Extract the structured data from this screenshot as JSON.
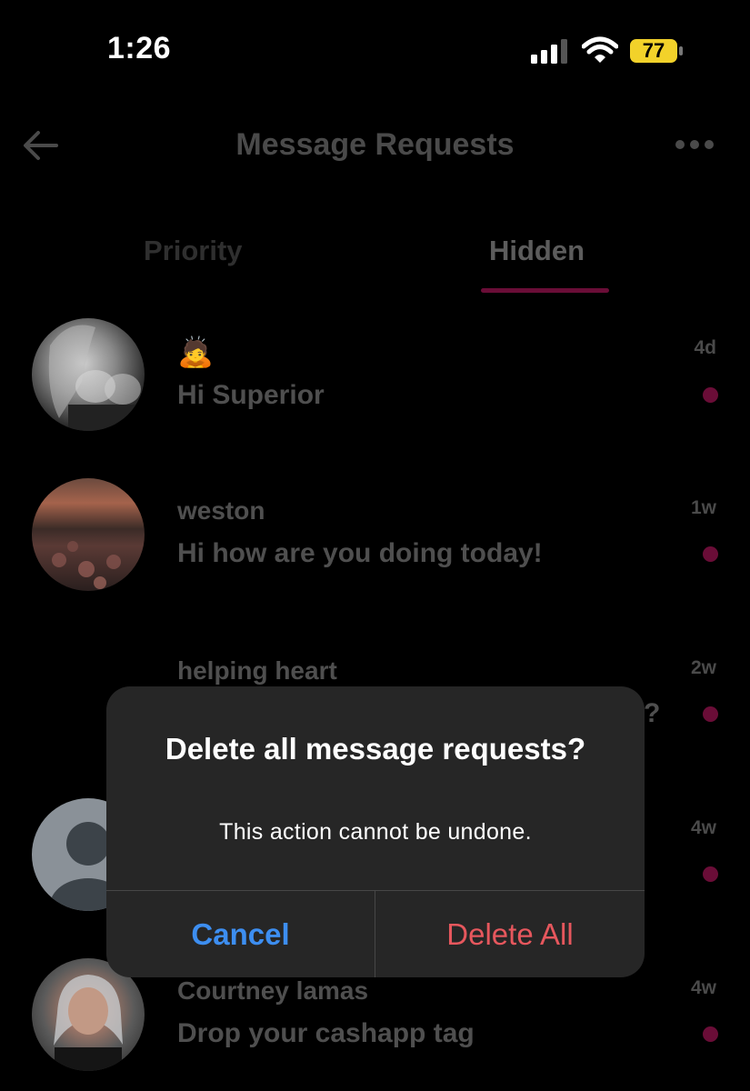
{
  "status_bar": {
    "time": "1:26",
    "battery": "77"
  },
  "header": {
    "title": "Message Requests"
  },
  "tabs": [
    {
      "label": "Priority",
      "selected": false
    },
    {
      "label": "Hidden",
      "selected": true
    }
  ],
  "requests": [
    {
      "name": "🙇",
      "preview": "Hi Superior",
      "time": "4d",
      "unread": true
    },
    {
      "name": "weston",
      "preview": "Hi how are you doing today!",
      "time": "1w",
      "unread": true
    },
    {
      "name": "helping heart",
      "preview": "?",
      "time": "2w",
      "unread": true
    },
    {
      "name": "",
      "preview": "",
      "time": "4w",
      "unread": true
    },
    {
      "name": "Courtney lamas",
      "preview": "Drop your cashapp tag",
      "time": "4w",
      "unread": true
    }
  ],
  "dialog": {
    "title": "Delete all message requests?",
    "message": "This action cannot be undone.",
    "cancel_label": "Cancel",
    "delete_label": "Delete All"
  },
  "colors": {
    "accent": "#6a0d37",
    "cancel": "#3d8ef0",
    "destructive": "#e6575d",
    "dialog_bg": "#262626",
    "battery": "#f2d22a"
  }
}
